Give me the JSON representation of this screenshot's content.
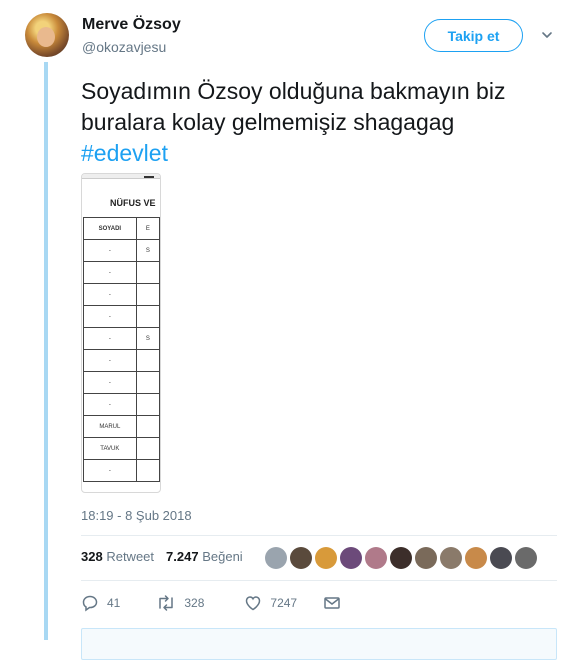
{
  "author": {
    "name": "Merve Özsoy",
    "handle": "@okozavjesu"
  },
  "follow_button": "Takip et",
  "tweet": {
    "text_line1": "Soyadımın Özsoy olduğuna bakmayın biz",
    "text_line2": "buralara kolay gelmemişiz shagagag",
    "hashtag": "#edevlet"
  },
  "media": {
    "title": "NÜFUS VE",
    "column_header_1": "SOYADI",
    "column_header_2": "E",
    "rows": [
      {
        "c1": "-",
        "c2": "S"
      },
      {
        "c1": "-",
        "c2": ""
      },
      {
        "c1": "-",
        "c2": ""
      },
      {
        "c1": "-",
        "c2": ""
      },
      {
        "c1": "-",
        "c2": "S"
      },
      {
        "c1": "-",
        "c2": ""
      },
      {
        "c1": "-",
        "c2": ""
      },
      {
        "c1": "-",
        "c2": ""
      },
      {
        "c1": "MARUL",
        "c2": ""
      },
      {
        "c1": "TAVUK",
        "c2": ""
      },
      {
        "c1": "-",
        "c2": ""
      }
    ]
  },
  "timestamp": "18:19 - 8 Şub 2018",
  "stats": {
    "retweets_count": "328",
    "retweets_label": "Retweet",
    "likes_count": "7.247",
    "likes_label": "Beğeni"
  },
  "likers": [
    "#9aa4ae",
    "#5a4a3c",
    "#d89a3a",
    "#6c4a7a",
    "#b07a8a",
    "#3c2e2a",
    "#7a6a5a",
    "#8a7a6a",
    "#c88a4a",
    "#4a4a52",
    "#6a6a6a"
  ],
  "actions": {
    "replies": "41",
    "retweets": "328",
    "likes": "7247"
  },
  "colors": {
    "accent": "#1da1f2",
    "muted": "#657786",
    "thread": "#a8d8f3"
  }
}
